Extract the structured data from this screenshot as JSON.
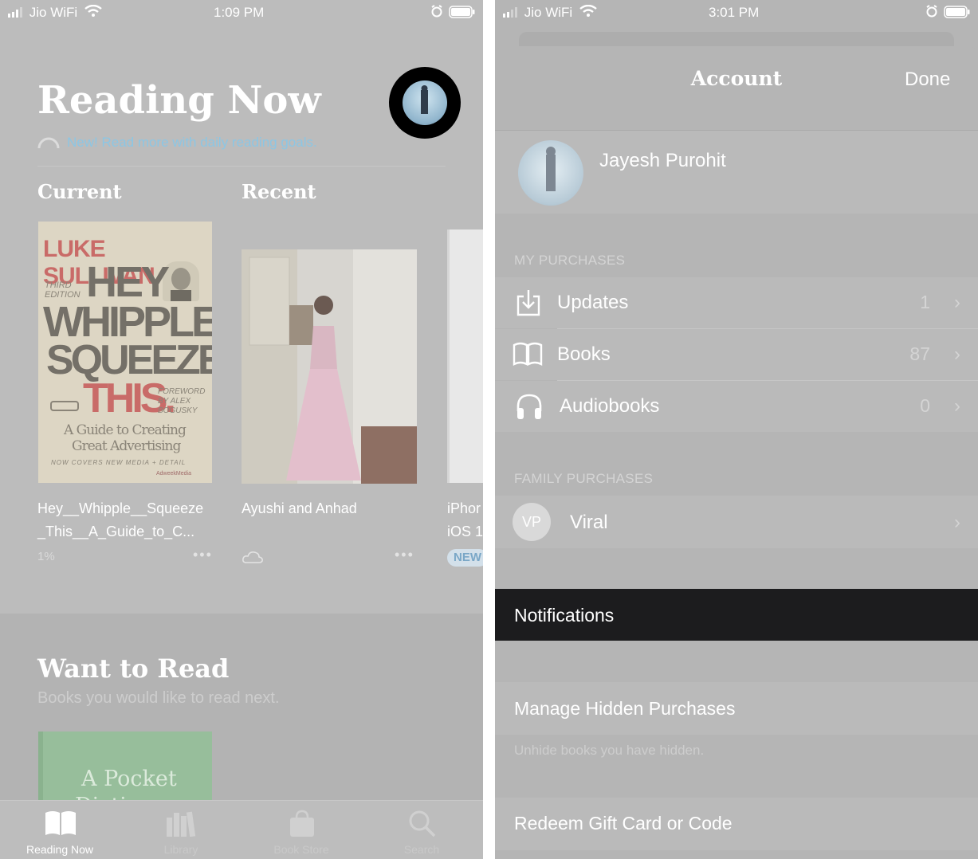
{
  "left": {
    "status": {
      "carrier": "Jio WiFi",
      "time": "1:09 PM"
    },
    "title": "Reading Now",
    "goal_promo": "New! Read more with daily reading goals.",
    "current_heading": "Current",
    "recent_heading": "Recent",
    "books": [
      {
        "title_line1": "Hey__Whipple__Squeeze",
        "title_line2": "_This__A_Guide_to_C...",
        "meta": "1%"
      },
      {
        "title_line1": "Ayushi and Anhad",
        "title_line2": ""
      },
      {
        "title_line1": "iPhor",
        "title_line2": "iOS 1",
        "badge": "NEW"
      }
    ],
    "cover1": {
      "author": "LUKE SULLIVAN",
      "l1": "HEY",
      "l2": "WHIPPLE,",
      "l3": "SQUEEZE",
      "l4": "THIS.",
      "edition": "THIRD EDITION",
      "foreword": "FOREWORD BY ALEX BOGUSKY",
      "subtitle1": "A Guide to Creating",
      "subtitle2": "Great Advertising",
      "footer": "NOW COVERS NEW MEDIA + DETAIL",
      "publisher": "AdweekMedia"
    },
    "want_heading": "Want to Read",
    "want_sub": "Books you would like to read next.",
    "pocket_cover": {
      "line1": "A Pocket",
      "line2": "Dicti"
    },
    "tabs": [
      {
        "label": "Reading Now",
        "icon": "book-open-icon"
      },
      {
        "label": "Library",
        "icon": "library-icon"
      },
      {
        "label": "Book Store",
        "icon": "shopping-bag-icon"
      },
      {
        "label": "Search",
        "icon": "search-icon"
      }
    ]
  },
  "right": {
    "status": {
      "carrier": "Jio WiFi",
      "time": "3:01 PM"
    },
    "title": "Account",
    "done": "Done",
    "user_name": "Jayesh Purohit",
    "my_purchases_header": "MY PURCHASES",
    "purchases": [
      {
        "label": "Updates",
        "count": "1",
        "icon": "download-tray-icon"
      },
      {
        "label": "Books",
        "count": "87",
        "icon": "open-book-icon"
      },
      {
        "label": "Audiobooks",
        "count": "0",
        "icon": "headphones-icon"
      }
    ],
    "family_header": "FAMILY PURCHASES",
    "family_member": {
      "initials": "VP",
      "name": "Viral"
    },
    "notifications": "Notifications",
    "manage_hidden": "Manage Hidden Purchases",
    "unhide_note": "Unhide books you have hidden.",
    "redeem": "Redeem Gift Card or Code"
  },
  "colors": {
    "dim_bg": "#bcbcbc",
    "accent_link": "#8cc6e4",
    "highlight_bar": "#1c1c1e",
    "avatar_ring": "#000000"
  }
}
